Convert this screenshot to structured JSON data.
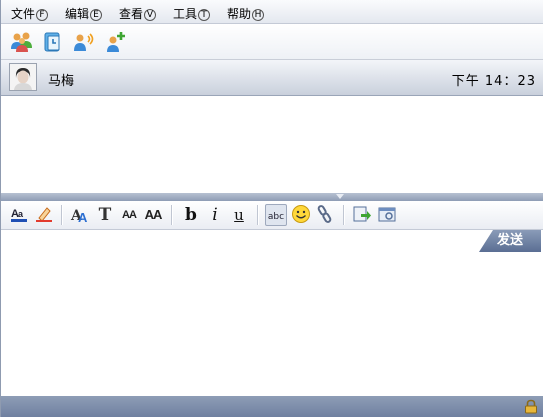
{
  "menu": {
    "items": [
      {
        "label": "文件",
        "key": "F"
      },
      {
        "label": "编辑",
        "key": "E"
      },
      {
        "label": "查看",
        "key": "V"
      },
      {
        "label": "工具",
        "key": "T"
      },
      {
        "label": "帮助",
        "key": "H"
      }
    ]
  },
  "toolbar_top": {
    "buttons": [
      "contacts-icon",
      "history-icon",
      "voice-call-icon",
      "add-contact-icon"
    ]
  },
  "contact": {
    "name": "马梅",
    "time": "下午 14：23"
  },
  "format_toolbar": {
    "buttons": [
      "font-color-icon",
      "highlight-icon",
      "font-face-icon",
      "font-type-icon",
      "font-size-small-icon",
      "font-size-large-icon",
      "bold-icon",
      "italic-icon",
      "underline-icon",
      "spellcheck-icon",
      "emoticon-icon",
      "link-icon",
      "send-file-icon",
      "screenshot-icon"
    ],
    "bold_glyph": "b",
    "italic_glyph": "i",
    "underline_glyph": "u",
    "spell_glyph": "abc",
    "fonttype_glyph": "T",
    "size_small_glyph": "AA",
    "size_large_glyph": "AA"
  },
  "send": {
    "label": "发送"
  },
  "input": {
    "value": ""
  },
  "colors": {
    "accent": "#6f80a0",
    "send_button": "#6c7fa3",
    "frame": "#8f9bb0"
  }
}
